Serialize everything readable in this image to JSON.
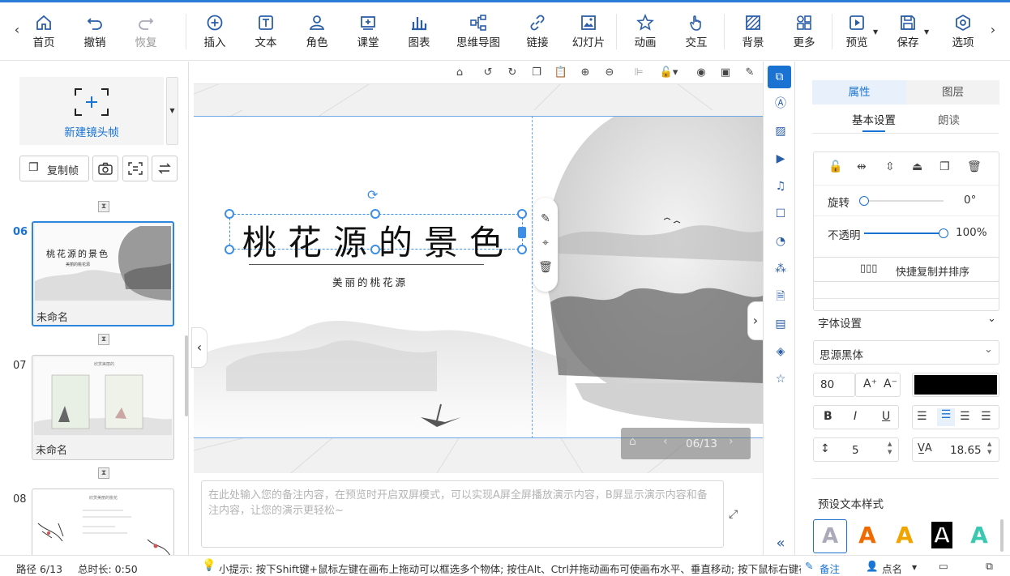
{
  "toolbar": {
    "items": [
      {
        "label": "首页",
        "icon": "home-icon"
      },
      {
        "label": "撤销",
        "icon": "undo-icon"
      },
      {
        "label": "恢复",
        "icon": "redo-icon"
      },
      {
        "label": "插入",
        "icon": "plus-circle-icon"
      },
      {
        "label": "文本",
        "icon": "text-icon"
      },
      {
        "label": "角色",
        "icon": "person-icon"
      },
      {
        "label": "课堂",
        "icon": "classroom-icon"
      },
      {
        "label": "图表",
        "icon": "bar-chart-icon"
      },
      {
        "label": "思维导图",
        "icon": "mindmap-icon"
      },
      {
        "label": "链接",
        "icon": "link-icon"
      },
      {
        "label": "幻灯片",
        "icon": "slide-icon"
      },
      {
        "label": "动画",
        "icon": "star-icon"
      },
      {
        "label": "交互",
        "icon": "hand-icon"
      },
      {
        "label": "背景",
        "icon": "background-icon"
      },
      {
        "label": "更多",
        "icon": "grid-icon"
      },
      {
        "label": "预览",
        "icon": "play-icon"
      },
      {
        "label": "保存",
        "icon": "save-icon"
      },
      {
        "label": "选项",
        "icon": "options-icon"
      }
    ]
  },
  "left": {
    "new_frame": "新建镜头帧",
    "copy_frame": "复制帧",
    "slides": [
      {
        "num": "06",
        "name": "未命名",
        "active": true,
        "title": "桃花源的景色",
        "subtitle": "美丽的桃花源"
      },
      {
        "num": "07",
        "name": "未命名",
        "active": false,
        "title": "欣赏美丽的",
        "subtitle": ""
      },
      {
        "num": "08",
        "name": "",
        "active": false,
        "title": "欣赏美丽的桃花",
        "subtitle": ""
      }
    ]
  },
  "canvas": {
    "title": "桃花源的景色",
    "subtitle": "美丽的桃花源",
    "page_indicator": "06/13"
  },
  "notes": {
    "placeholder": "在此处输入您的备注内容，在预览时开启双屏模式，可以实现A屏全屏播放演示内容，B屏显示演示内容和备注内容，让您的演示更轻松~"
  },
  "props": {
    "tabs": [
      "属性",
      "图层"
    ],
    "subtabs": [
      "基本设置",
      "朗读"
    ],
    "rotate_label": "旋转",
    "rotate_value": "0°",
    "rotate_level": 0,
    "opacity_label": "不透明",
    "opacity_value": "100%",
    "opacity_level": 1,
    "quick_copy": "快捷复制并排序",
    "font_section": "字体设置",
    "font_family": "思源黑体",
    "font_size": "80",
    "font_color": "#000000",
    "line_spacing": "5",
    "letter_spacing": "18.65",
    "preset_title": "预设文本样式"
  },
  "status": {
    "path": "路径 6/13",
    "duration": "总时长: 0:50",
    "tip": "小提示: 按下Shift键+鼠标左键在画布上拖动可以框选多个物体; 按住Alt、Ctrl并拖动画布可使画布水平、垂直移动; 按下鼠标右键在画布",
    "notes_btn": "备注",
    "rollcall_btn": "点名"
  },
  "colors": {
    "accent": "#1a73d2",
    "selected_tab_bg": "#e8f1fb"
  }
}
